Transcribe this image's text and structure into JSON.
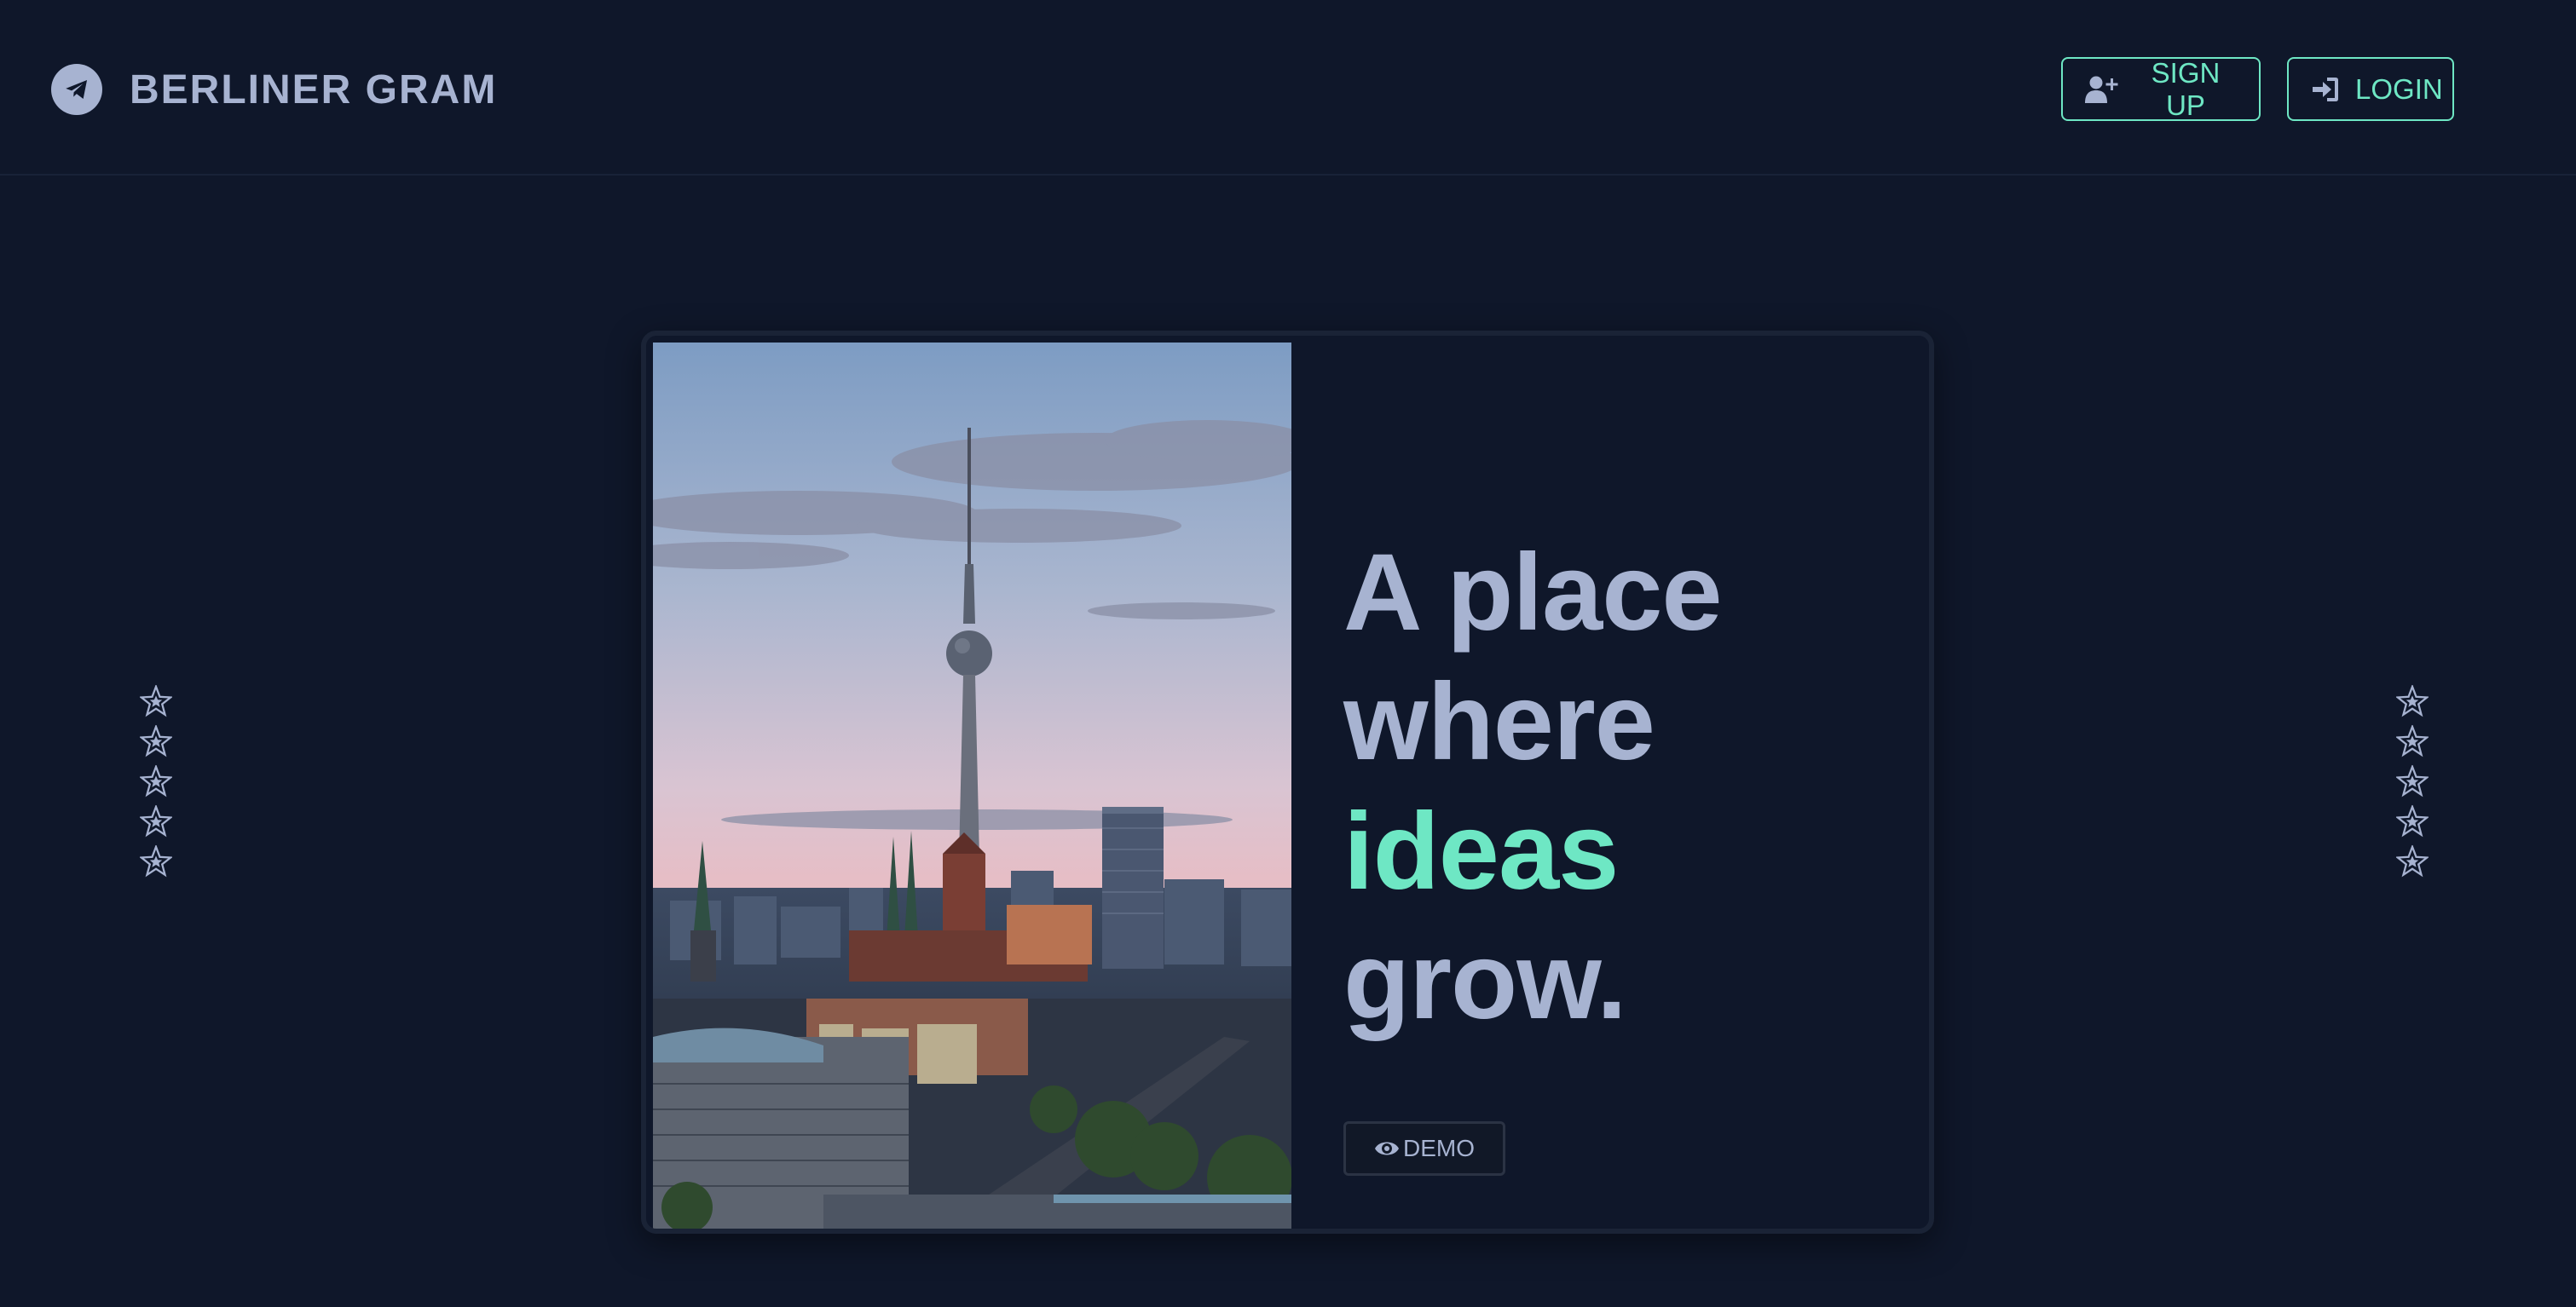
{
  "header": {
    "brand": "BERLINER GRAM",
    "logo_icon": "paper-plane-icon",
    "signup_label": "SIGN UP",
    "signup_icon": "user-plus-icon",
    "login_label": "LOGIN",
    "login_icon": "sign-in-icon"
  },
  "hero": {
    "image_subject": "Berlin skyline with TV tower at sunset",
    "headline": {
      "line1": "A place",
      "line2": "where",
      "line3": "ideas",
      "line4": "grow."
    },
    "demo_label": "DEMO",
    "demo_icon": "eye-icon"
  },
  "decor": {
    "star_icon": "star-icon",
    "stars_per_column": 5
  },
  "colors": {
    "background": "#0f172a",
    "text": "#a7b3d1",
    "accent": "#6ee7c4",
    "card_border": "#1a2336"
  }
}
